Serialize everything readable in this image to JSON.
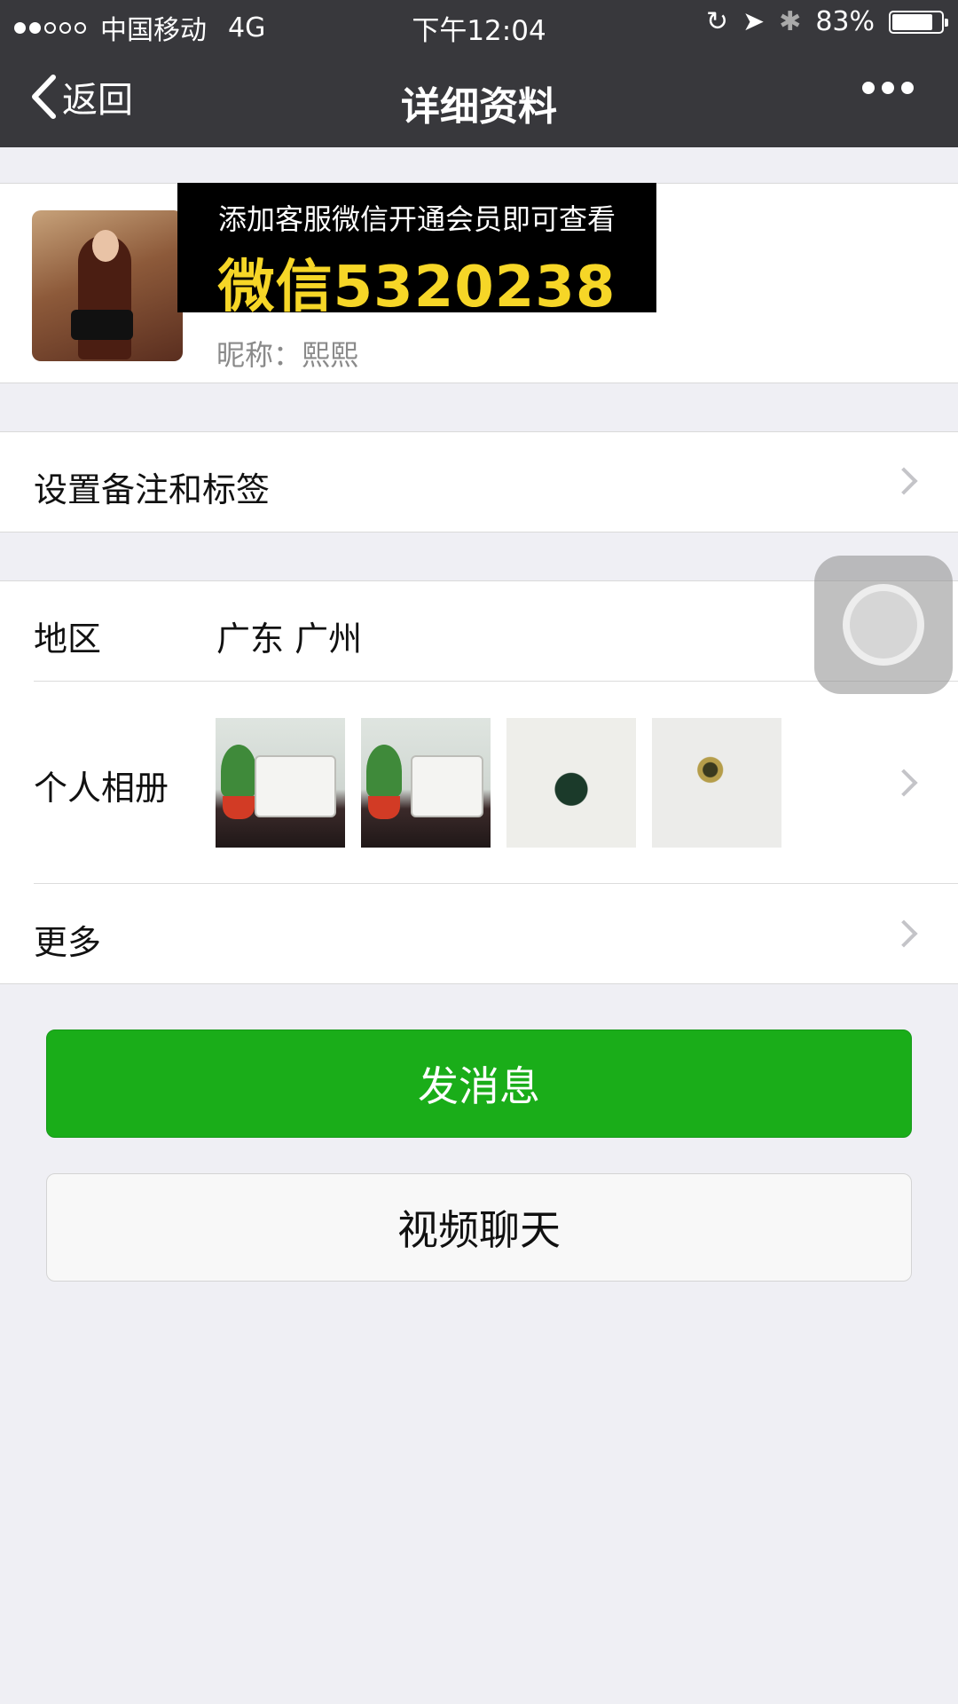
{
  "status_bar": {
    "carrier": "中国移动",
    "network": "4G",
    "time": "下午12:04",
    "battery": "83%",
    "battery_level": 0.83
  },
  "nav": {
    "back_label": "返回",
    "title": "详细资料",
    "more_icon": "ellipsis-icon"
  },
  "profile": {
    "nickname_label": "昵称：",
    "nickname": "熙熙"
  },
  "promo": {
    "line1": "添加客服微信开通会员即可查看",
    "line2": "微信5320238"
  },
  "rows": {
    "remark_label": "设置备注和标签",
    "region_label": "地区",
    "region_value": "广东 广州",
    "album_label": "个人相册",
    "more_label": "更多"
  },
  "buttons": {
    "send": "发消息",
    "video": "视频聊天"
  },
  "colors": {
    "nav_bg": "#38383c",
    "accent_green": "#1aad19",
    "promo_yellow": "#f6d627"
  }
}
